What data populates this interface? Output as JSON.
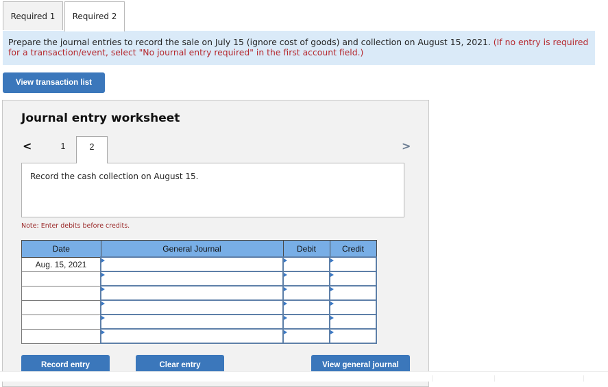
{
  "tabs": [
    {
      "label": "Required 1",
      "active": false
    },
    {
      "label": "Required 2",
      "active": true
    }
  ],
  "instructions": {
    "main": "Prepare the journal entries to record the sale on July 15 (ignore cost of goods) and collection on August 15, 2021.",
    "note": "(If no entry is required for a transaction/event, select \"No journal entry required\" in the first account field.)"
  },
  "buttons": {
    "view_transaction_list": "View transaction list",
    "record_entry": "Record entry",
    "clear_entry": "Clear entry",
    "view_general_journal": "View general journal"
  },
  "worksheet": {
    "title": "Journal entry worksheet",
    "prev_icon": "<",
    "next_icon": ">",
    "entry_tabs": [
      "1",
      "2"
    ],
    "active_entry": "2",
    "prompt": "Record the cash collection on August 15.",
    "note": "Note: Enter debits before credits.",
    "columns": [
      "Date",
      "General Journal",
      "Debit",
      "Credit"
    ],
    "rows": [
      {
        "date": "Aug. 15, 2021",
        "account": "",
        "debit": "",
        "credit": ""
      },
      {
        "date": "",
        "account": "",
        "debit": "",
        "credit": ""
      },
      {
        "date": "",
        "account": "",
        "debit": "",
        "credit": ""
      },
      {
        "date": "",
        "account": "",
        "debit": "",
        "credit": ""
      },
      {
        "date": "",
        "account": "",
        "debit": "",
        "credit": ""
      },
      {
        "date": "",
        "account": "",
        "debit": "",
        "credit": ""
      }
    ]
  },
  "colors": {
    "accent_button": "#3b77bb",
    "instruction_bg": "#daeaf8",
    "note_red": "#b5282e",
    "table_header": "#78aee6"
  }
}
